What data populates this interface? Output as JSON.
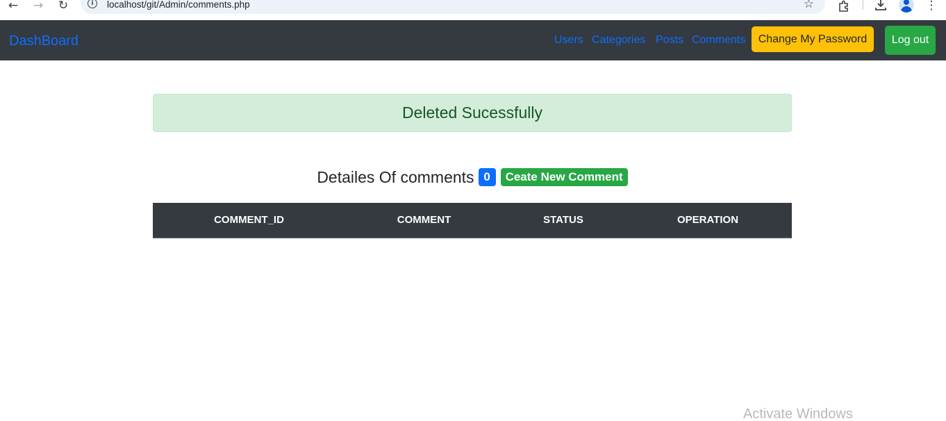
{
  "browser": {
    "url": "localhost/git/Admin/comments.php"
  },
  "navbar": {
    "brand": "DashBoard",
    "links": [
      {
        "label": "Users"
      },
      {
        "label": "Categories"
      },
      {
        "label": "Posts"
      },
      {
        "label": "Comments"
      }
    ],
    "change_password_label": "Change My Password",
    "logout_label": "Log out"
  },
  "alert": {
    "message": "Deleted Sucessfully"
  },
  "heading": {
    "title": "Detailes Of comments",
    "count": "0",
    "create_label": "Ceate New Comment"
  },
  "table": {
    "columns": [
      "COMMENT_ID",
      "COMMENT",
      "STATUS",
      "OPERATION"
    ],
    "rows": []
  },
  "watermark": "Activate Windows",
  "colors": {
    "navbar_bg": "#343a40",
    "link": "#0d6efd",
    "warning": "#ffc107",
    "success": "#28a745",
    "alert_bg": "#d4edda",
    "alert_text": "#155724"
  },
  "icons": [
    "back-arrow-icon",
    "forward-arrow-icon",
    "reload-icon",
    "site-info-icon",
    "bookmark-star-icon",
    "extensions-icon",
    "download-icon",
    "profile-avatar-icon",
    "more-menu-icon"
  ]
}
